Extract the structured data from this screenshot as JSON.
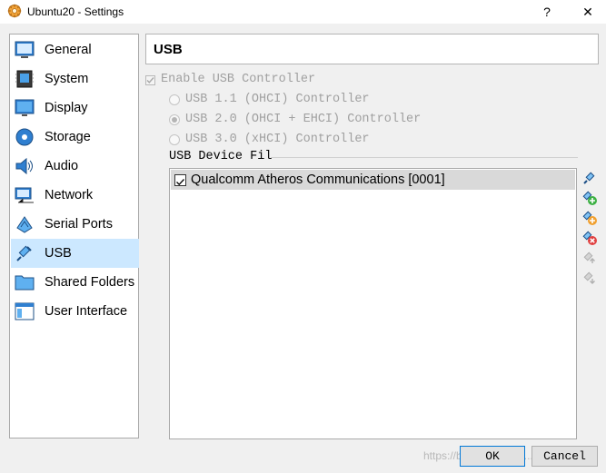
{
  "window": {
    "title": "Ubuntu20 - Settings",
    "help_glyph": "?",
    "close_glyph": "✕"
  },
  "sidebar": {
    "items": [
      {
        "label": "General",
        "icon": "general-icon",
        "selected": false
      },
      {
        "label": "System",
        "icon": "system-icon",
        "selected": false
      },
      {
        "label": "Display",
        "icon": "display-icon",
        "selected": false
      },
      {
        "label": "Storage",
        "icon": "storage-icon",
        "selected": false
      },
      {
        "label": "Audio",
        "icon": "audio-icon",
        "selected": false
      },
      {
        "label": "Network",
        "icon": "network-icon",
        "selected": false
      },
      {
        "label": "Serial Ports",
        "icon": "serial-ports-icon",
        "selected": false
      },
      {
        "label": "USB",
        "icon": "usb-icon",
        "selected": true
      },
      {
        "label": "Shared Folders",
        "icon": "shared-folders-icon",
        "selected": false
      },
      {
        "label": "User Interface",
        "icon": "user-interface-icon",
        "selected": false
      }
    ]
  },
  "page": {
    "title": "USB",
    "enable_usb_label": "Enable USB Controller",
    "enable_usb_checked": true,
    "controllers": [
      {
        "label": "USB 1.1 (OHCI) Controller",
        "selected": false
      },
      {
        "label": "USB 2.0 (OHCI + EHCI) Controller",
        "selected": true
      },
      {
        "label": "USB 3.0 (xHCI) Controller",
        "selected": false
      }
    ],
    "filters_label": "USB Device Fil",
    "filters": [
      {
        "label": "Qualcomm Atheros Communications  [0001]",
        "checked": true
      }
    ],
    "filter_tools": [
      "usb-filter-icon",
      "add-filter-icon",
      "add-filter-from-device-icon",
      "remove-filter-icon",
      "move-filter-up-icon",
      "move-filter-down-icon"
    ]
  },
  "buttons": {
    "ok": "OK",
    "cancel": "Cancel"
  },
  "watermark": "https://blog.csdn.net/...ual",
  "colors": {
    "selection": "#cce8ff",
    "accent": "#0078d7",
    "disabled_text": "#a0a0a0"
  }
}
